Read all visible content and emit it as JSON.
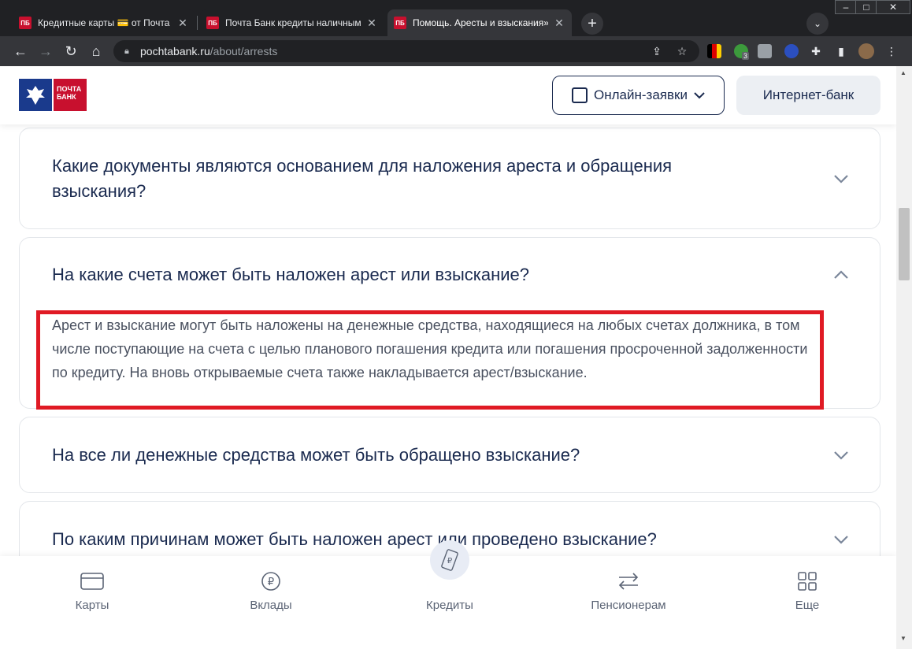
{
  "browser": {
    "tabs": [
      {
        "favicon": "ПБ",
        "title": "Кредитные карты 💳 от Почта Банк",
        "active": false
      },
      {
        "favicon": "ПБ",
        "title": "Почта Банк кредиты наличными, д",
        "active": false
      },
      {
        "favicon": "ПБ",
        "title": "Помощь. Аресты и взыскания» - П",
        "active": true
      }
    ],
    "url_host": "pochtabank.ru",
    "url_path": "/about/arrests",
    "extension_badge": "3"
  },
  "header": {
    "logo_text": "ПОЧТА БАНК",
    "online_button": "Онлайн-заявки",
    "bank_button": "Интернет-банк"
  },
  "faq": [
    {
      "question": "Какие документы являются основанием для наложения ареста и обращения взыскания?",
      "expanded": false
    },
    {
      "question": "На какие счета может быть наложен арест или взыскание?",
      "expanded": true,
      "answer": "Арест и взыскание могут быть наложены на денежные средства, находящиеся на любых счетах должника, в том числе поступающие на счета с целью планового погашения кредита или погашения просроченной задолженности по кредиту. На вновь открываемые счета также накладывается арест/взыскание."
    },
    {
      "question": "На все ли денежные средства может быть обращено взыскание?",
      "expanded": false
    },
    {
      "question": "По каким причинам может быть наложен арест или проведено взыскание?",
      "expanded": false
    }
  ],
  "bottom_nav": [
    {
      "label": "Карты",
      "icon": "card-icon"
    },
    {
      "label": "Вклады",
      "icon": "ruble-coin-icon"
    },
    {
      "label": "Кредиты",
      "icon": "ruble-note-icon"
    },
    {
      "label": "Пенсионерам",
      "icon": "swap-arrows-icon"
    },
    {
      "label": "Еще",
      "icon": "grid-icon"
    }
  ],
  "colors": {
    "brand_navy": "#1a2a4f",
    "brand_red": "#c8102e",
    "highlight_red": "#e01a24"
  }
}
